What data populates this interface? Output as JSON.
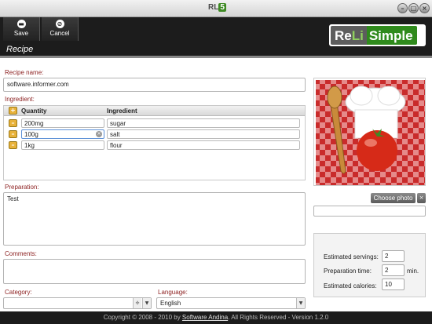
{
  "titlebar": {
    "logo_rl": "RL",
    "logo_s": "5"
  },
  "toolbar": {
    "save_label": "Save",
    "cancel_label": "Cancel"
  },
  "brand": {
    "reli_a": "Re",
    "reli_b": "Li",
    "simple": "Simple"
  },
  "header": {
    "title": "Recipe"
  },
  "recipe_name": {
    "label": "Recipe name:",
    "value": "software.informer.com"
  },
  "ingredient": {
    "label": "Ingredient:",
    "col_quantity": "Quantity",
    "col_ingredient": "Ingredient",
    "rows": [
      {
        "quantity": "200mg",
        "ingredient": "sugar"
      },
      {
        "quantity": "100g",
        "ingredient": "salt"
      },
      {
        "quantity": "1kg",
        "ingredient": "flour"
      }
    ]
  },
  "preparation": {
    "label": "Preparation:",
    "value": "Test"
  },
  "comments": {
    "label": "Comments:",
    "value": ""
  },
  "category": {
    "label": "Category:",
    "value": ""
  },
  "language": {
    "label": "Language:",
    "value": "English"
  },
  "photo": {
    "choose_label": "Choose photo",
    "path": ""
  },
  "estimates": {
    "servings_label": "Estimated servings:",
    "servings": "2",
    "prep_label": "Preparation time:",
    "prep": "2",
    "prep_unit": "min.",
    "calories_label": "Estimated calories:",
    "calories": "10"
  },
  "footer": {
    "prefix": "Copyright © 2008 - 2010 by ",
    "link": "Software Andina",
    "suffix": ". All Rights Reserved  - Version 1.2.0"
  },
  "colors": {
    "accent_green": "#2f8a1c",
    "label_red": "#8b1e1e",
    "dark_bar": "#1c1c1c"
  },
  "icons": [
    "save-icon",
    "cancel-icon",
    "add-icon",
    "remove-icon",
    "minimize-icon",
    "maximize-icon",
    "close-icon"
  ]
}
